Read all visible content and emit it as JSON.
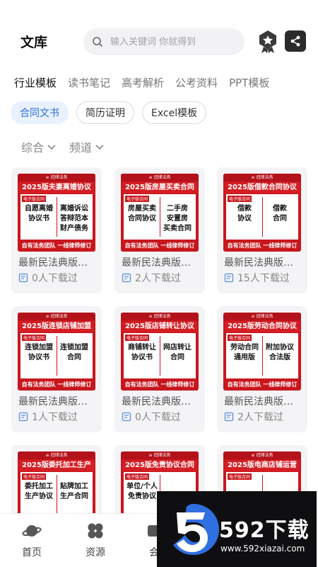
{
  "header": {
    "title": "文库",
    "search_placeholder": "输入关键词 你就得到"
  },
  "category_tabs": [
    "行业模板",
    "读书笔记",
    "高考解析",
    "公考资料",
    "PPT模板"
  ],
  "sub_tabs": [
    "合同文书",
    "简历证明",
    "Excel模板"
  ],
  "filters": [
    "综合",
    "频道"
  ],
  "thumb_common": {
    "top": "≡ 冠律法务",
    "tag": "电子版合同",
    "foot": "自有法务团队 一线律师修订"
  },
  "cards": [
    {
      "headline": "2025版夫妻离婚协议",
      "left": "自愿离婚\n协议书",
      "right": "离婚诉讼\n答辩范本\n财产债务",
      "title": "最新民法典版…",
      "downloads": "0人下载过"
    },
    {
      "headline": "2025版房屋买卖合同",
      "left": "房屋买卖\n合同协议",
      "right": "二手房\n安置房\n买卖合同",
      "title": "最新民法典版…",
      "downloads": "2人下载过"
    },
    {
      "headline": "2025版借款合同协议",
      "left": "借款\n协议",
      "right": "借款\n合同",
      "title": "最新民法典版…",
      "downloads": "15人下载过"
    },
    {
      "headline": "2025版连锁店铺加盟",
      "left": "连锁加盟\n协议书",
      "right": "连锁加盟\n合同",
      "title": "最新民法典版…",
      "downloads": "1人下载过"
    },
    {
      "headline": "2025版店铺转让协议",
      "left": "商铺转让\n协议书",
      "right": "网店转让\n合同",
      "title": "最新民法典版…",
      "downloads": "0人下载过"
    },
    {
      "headline": "2025版劳动合同协议",
      "left": "劳动合同\n通用版",
      "right": "附加协议\n合法版",
      "title": "最新民法典版…",
      "downloads": "2人下载过"
    },
    {
      "headline": "2025版委托加工生产",
      "left": "委托加工\n生产协议",
      "right": "贴牌加工\n生产合同",
      "title": "",
      "downloads": ""
    },
    {
      "headline": "2025版免责协议合同",
      "left": "单位/个人\n免责协议",
      "right": "",
      "title": "",
      "downloads": ""
    },
    {
      "headline": "2025版电商店铺运营",
      "left": "",
      "right": "",
      "title": "",
      "downloads": ""
    }
  ],
  "bottom_nav": [
    "首页",
    "资源",
    "会"
  ],
  "watermark": {
    "brand": "592下载",
    "url": "www.592xiazai.com"
  },
  "colors": {
    "accent": "#2d6fd8",
    "chip_active_bg": "#e8f1fd",
    "thumb_red": "#c8161d"
  }
}
